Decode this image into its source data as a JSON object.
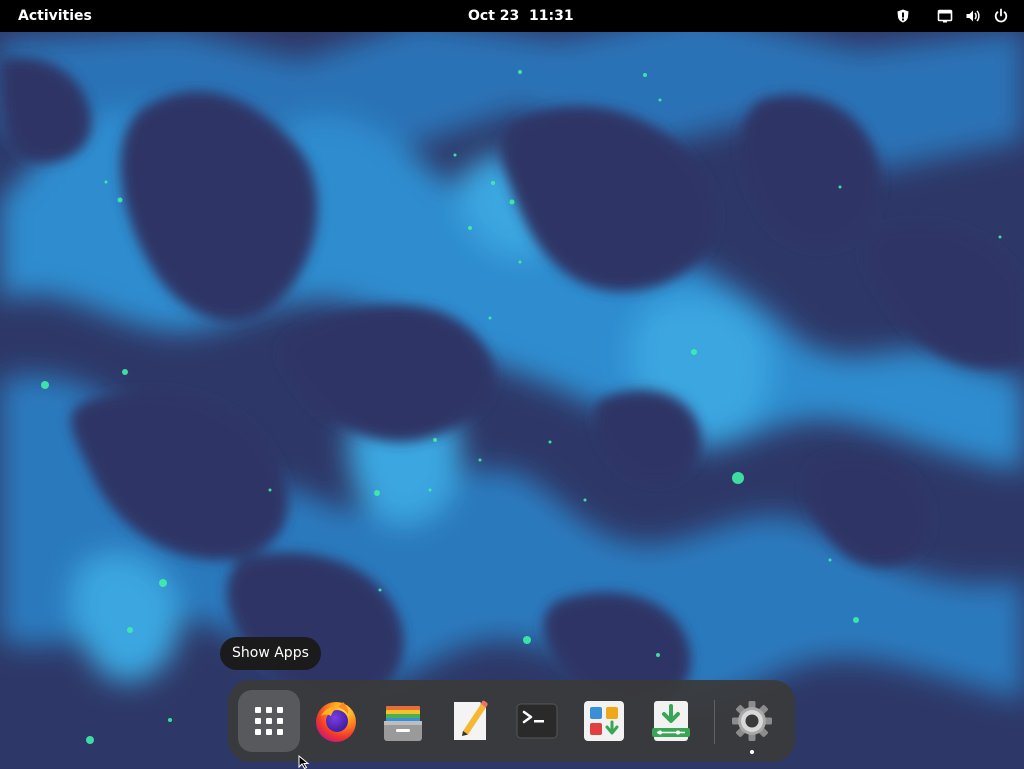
{
  "topbar": {
    "activities_label": "Activities",
    "clock": "Oct 23  11:31",
    "tray_icons": [
      "shield-icon",
      "network-icon",
      "volume-icon",
      "power-icon"
    ]
  },
  "dash": {
    "tooltip": "Show Apps",
    "items": [
      {
        "name": "show-apps",
        "icon": "grid-icon"
      },
      {
        "name": "firefox",
        "icon": "firefox-icon"
      },
      {
        "name": "files",
        "icon": "file-cabinet-icon"
      },
      {
        "name": "text-editor",
        "icon": "text-editor-icon"
      },
      {
        "name": "terminal",
        "icon": "terminal-icon"
      },
      {
        "name": "software",
        "icon": "software-store-icon"
      },
      {
        "name": "install-media",
        "icon": "install-icon"
      },
      {
        "name": "settings",
        "icon": "gear-icon",
        "running": true
      }
    ]
  },
  "colors": {
    "topbar_bg": "#000000",
    "dash_bg": "#3a3a3a",
    "wallpaper_dark": "#2d3566",
    "wallpaper_light": "#2e86c8",
    "wallpaper_spark": "#3ff0a8"
  }
}
